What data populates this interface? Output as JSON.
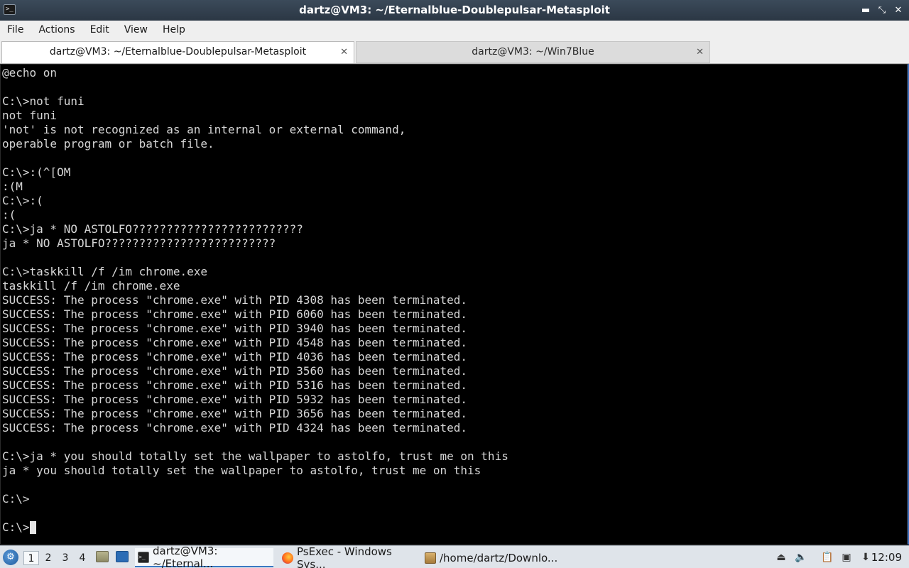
{
  "window": {
    "title": "dartz@VM3: ~/Eternalblue-Doublepulsar-Metasploit",
    "controls": {
      "minimize": "▬",
      "maximize": "⤡",
      "close": "✕"
    }
  },
  "menu": {
    "items": [
      "File",
      "Actions",
      "Edit",
      "View",
      "Help"
    ]
  },
  "tabs": [
    {
      "label": "dartz@VM3: ~/Eternalblue-Doublepulsar-Metasploit",
      "active": true,
      "close": "✕"
    },
    {
      "label": "dartz@VM3: ~/Win7Blue",
      "active": false,
      "close": "✕"
    }
  ],
  "terminal": {
    "lines": [
      "@echo on",
      "",
      "C:\\>not funi",
      "not funi",
      "'not' is not recognized as an internal or external command,",
      "operable program or batch file.",
      "",
      "C:\\>:(^[OM",
      ":(M",
      "C:\\>:(",
      ":(",
      "C:\\>ja * NO ASTOLFO?????????????????????????",
      "ja * NO ASTOLFO?????????????????????????",
      "",
      "C:\\>taskkill /f /im chrome.exe",
      "taskkill /f /im chrome.exe",
      "SUCCESS: The process \"chrome.exe\" with PID 4308 has been terminated.",
      "SUCCESS: The process \"chrome.exe\" with PID 6060 has been terminated.",
      "SUCCESS: The process \"chrome.exe\" with PID 3940 has been terminated.",
      "SUCCESS: The process \"chrome.exe\" with PID 4548 has been terminated.",
      "SUCCESS: The process \"chrome.exe\" with PID 4036 has been terminated.",
      "SUCCESS: The process \"chrome.exe\" with PID 3560 has been terminated.",
      "SUCCESS: The process \"chrome.exe\" with PID 5316 has been terminated.",
      "SUCCESS: The process \"chrome.exe\" with PID 5932 has been terminated.",
      "SUCCESS: The process \"chrome.exe\" with PID 3656 has been terminated.",
      "SUCCESS: The process \"chrome.exe\" with PID 4324 has been terminated.",
      "",
      "C:\\>ja * you should totally set the wallpaper to astolfo, trust me on this",
      "ja * you should totally set the wallpaper to astolfo, trust me on this",
      "",
      "C:\\>",
      "",
      "C:\\>"
    ]
  },
  "taskbar": {
    "start_icon": "start-menu-icon",
    "desktops": [
      "1",
      "2",
      "3",
      "4"
    ],
    "tasks": [
      {
        "label": "dartz@VM3: ~/Eternal...",
        "icon": "terminal-icon",
        "active": true
      },
      {
        "label": "PsExec - Windows Sys...",
        "icon": "firefox-icon",
        "active": false
      },
      {
        "label": "/home/dartz/Downlo...",
        "icon": "archive-icon",
        "active": false
      }
    ],
    "clock": "12:09"
  }
}
